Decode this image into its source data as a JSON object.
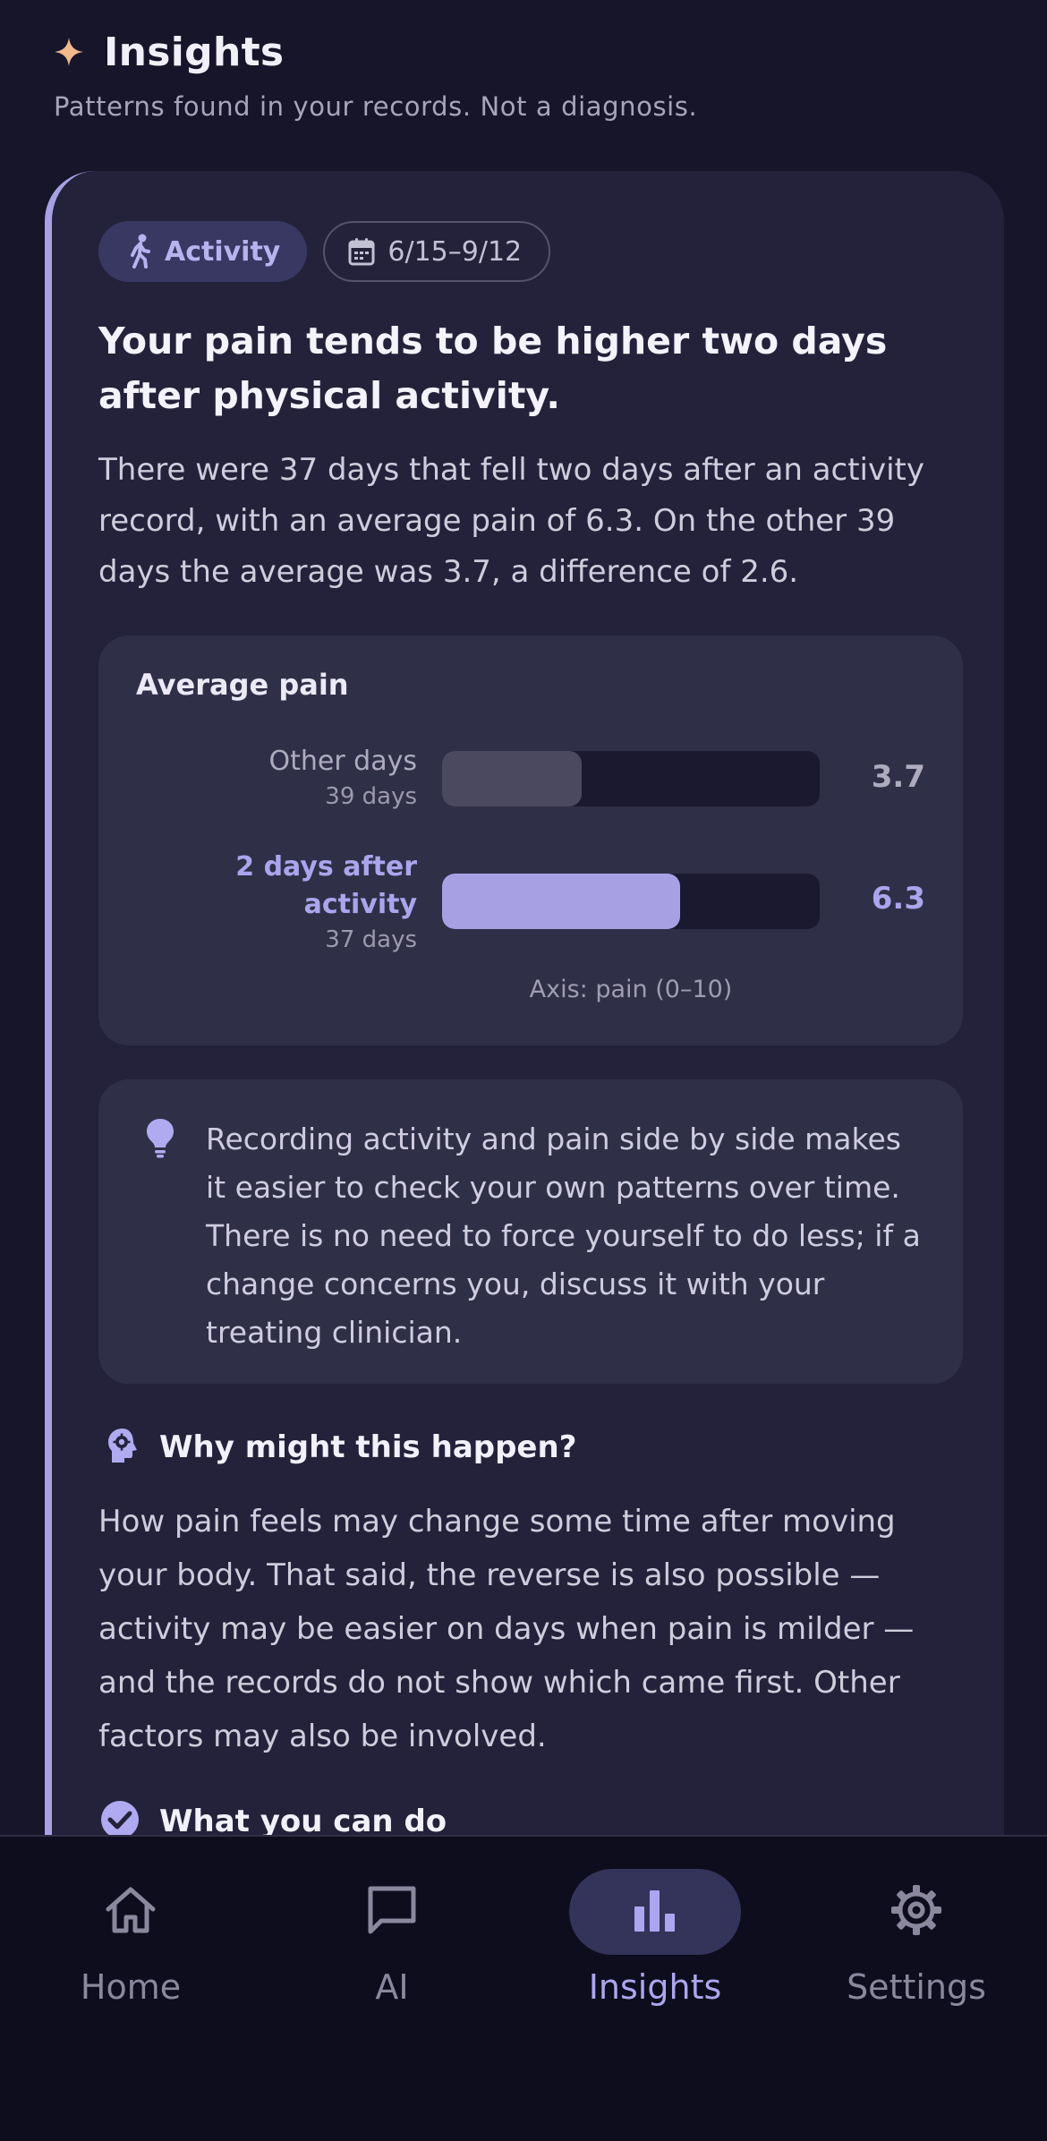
{
  "header": {
    "title": "Insights",
    "subtitle": "Patterns found in your records. Not a diagnosis.",
    "icon": "sparkle-icon",
    "accent": "#f2b98d"
  },
  "insight": {
    "category_chip": "Activity",
    "date_chip": "6/15–9/12",
    "headline": "Your pain tends to be higher two days after physical activity.",
    "summary": "There were 37 days that fell two days after an activity record, with an average pain of 6.3. On the other 39 days the average was 3.7, a difference of 2.6."
  },
  "chart": {
    "title": "Average pain",
    "axis_note": "Axis: pain (0–10)",
    "rows": [
      {
        "name": "Other days",
        "sub": "39 days",
        "value_text": "3.7"
      },
      {
        "name_line1": "2 days after",
        "name_line2": "activity",
        "sub": "37 days",
        "value_text": "6.3"
      }
    ]
  },
  "chart_data": {
    "type": "bar",
    "title": "Average pain",
    "categories": [
      "Other days",
      "2 days after activity"
    ],
    "values": [
      3.7,
      6.3
    ],
    "counts": [
      "39 days",
      "37 days"
    ],
    "xlabel": "Axis: pain (0–10)",
    "xlim": [
      0,
      10
    ],
    "colors": [
      "#4a4960",
      "#a7a1e4"
    ]
  },
  "tip": {
    "icon": "lightbulb-icon",
    "text": "Recording activity and pain side by side makes it easier to check your own patterns over time. There is no need to force yourself to do less; if a change concerns you, discuss it with your treating clinician."
  },
  "why": {
    "icon": "head-gear-icon",
    "title": "Why might this happen?",
    "text": "How pain feels may change some time after moving your body. That said, the reverse is also possible — activity may be easier on days when pain is milder — and the records do not show which came first. Other factors may also be involved."
  },
  "next": {
    "icon": "check-circle-icon",
    "title": "What you can do"
  },
  "nav": {
    "items": [
      {
        "label": "Home",
        "icon": "home-icon"
      },
      {
        "label": "AI",
        "icon": "chat-icon"
      },
      {
        "label": "Insights",
        "icon": "bar-chart-icon",
        "active": true
      },
      {
        "label": "Settings",
        "icon": "gear-icon"
      }
    ]
  },
  "colors": {
    "background": "#16152a",
    "card": "#23223a",
    "accent": "#a7a1e4"
  }
}
